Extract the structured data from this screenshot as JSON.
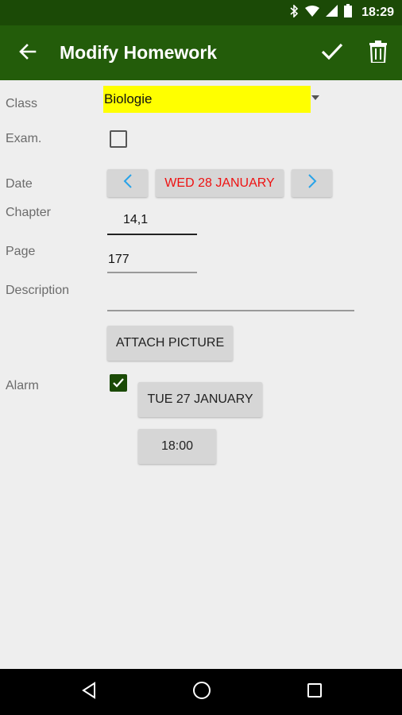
{
  "status_bar": {
    "time": "18:29",
    "icons": [
      "bluetooth-icon",
      "wifi-icon",
      "signal-icon",
      "battery-icon"
    ]
  },
  "app_bar": {
    "title": "Modify Homework",
    "back_icon": "arrow-left-icon",
    "save_icon": "check-icon",
    "delete_icon": "trash-icon"
  },
  "form": {
    "class": {
      "label": "Class",
      "value": "Biologie",
      "highlight_color": "#ffff00"
    },
    "exam": {
      "label": "Exam.",
      "checked": false
    },
    "date": {
      "label": "Date",
      "value": "WED 28 JANUARY",
      "value_color": "#ee1111"
    },
    "chapter": {
      "label": "Chapter",
      "value": "14,1"
    },
    "page": {
      "label": "Page",
      "value": "177"
    },
    "description": {
      "label": "Description",
      "value": ""
    },
    "attach_button": "ATTACH PICTURE",
    "alarm": {
      "label": "Alarm",
      "checked": true,
      "date": "TUE 27 JANUARY",
      "time": "18:00"
    }
  },
  "nav_bar": {
    "items": [
      "back-triangle-icon",
      "home-circle-icon",
      "recents-square-icon"
    ]
  },
  "colors": {
    "status_bar": "#1b4a06",
    "app_bar": "#235c0a",
    "background": "#eeeeee"
  }
}
